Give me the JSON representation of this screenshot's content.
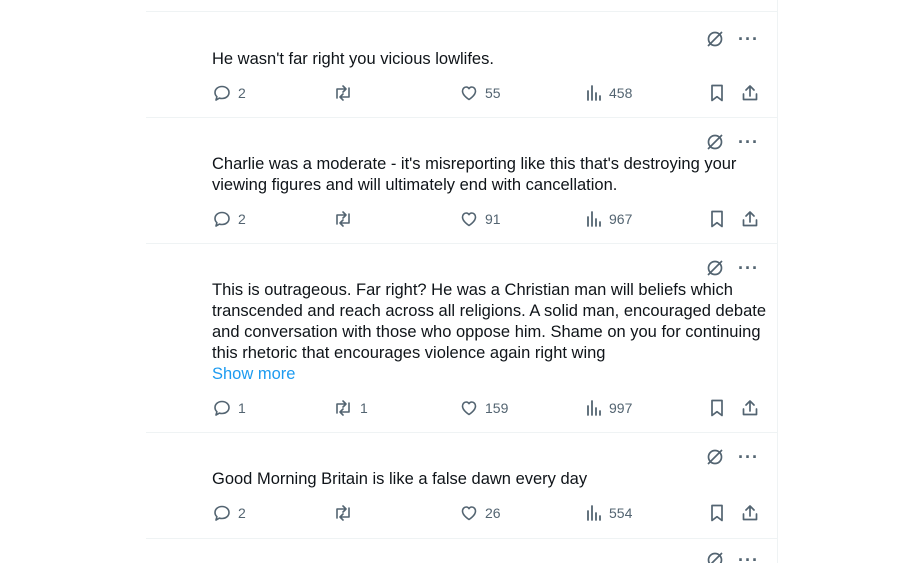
{
  "posts": [
    {
      "text": "He wasn't far right you vicious lowlifes.",
      "replies": "2",
      "reposts": "",
      "likes": "55",
      "views": "458"
    },
    {
      "text": "Charlie was a moderate - it's misreporting like this that's destroying your viewing figures and will ultimately end with cancellation.",
      "replies": "2",
      "reposts": "",
      "likes": "91",
      "views": "967"
    },
    {
      "text": "This is outrageous. Far right? He was a Christian man will beliefs which transcended and reach across all religions. A solid man, encouraged debate and conversation with those who oppose him. Shame on you for continuing this rhetoric that encourages violence again right wing",
      "show_more": "Show more",
      "replies": "1",
      "reposts": "1",
      "likes": "159",
      "views": "997"
    },
    {
      "text": "Good Morning Britain is like a false dawn every day",
      "replies": "2",
      "reposts": "",
      "likes": "26",
      "views": "554"
    }
  ],
  "icons": {
    "top": [
      "grok-icon",
      "more-icon"
    ],
    "actions": [
      "reply-icon",
      "repost-icon",
      "like-icon",
      "views-icon",
      "bookmark-icon",
      "share-icon"
    ]
  },
  "colors": {
    "text": "#0f1419",
    "muted": "#536471",
    "link": "#1d9bf0",
    "divider": "#eff3f4"
  }
}
